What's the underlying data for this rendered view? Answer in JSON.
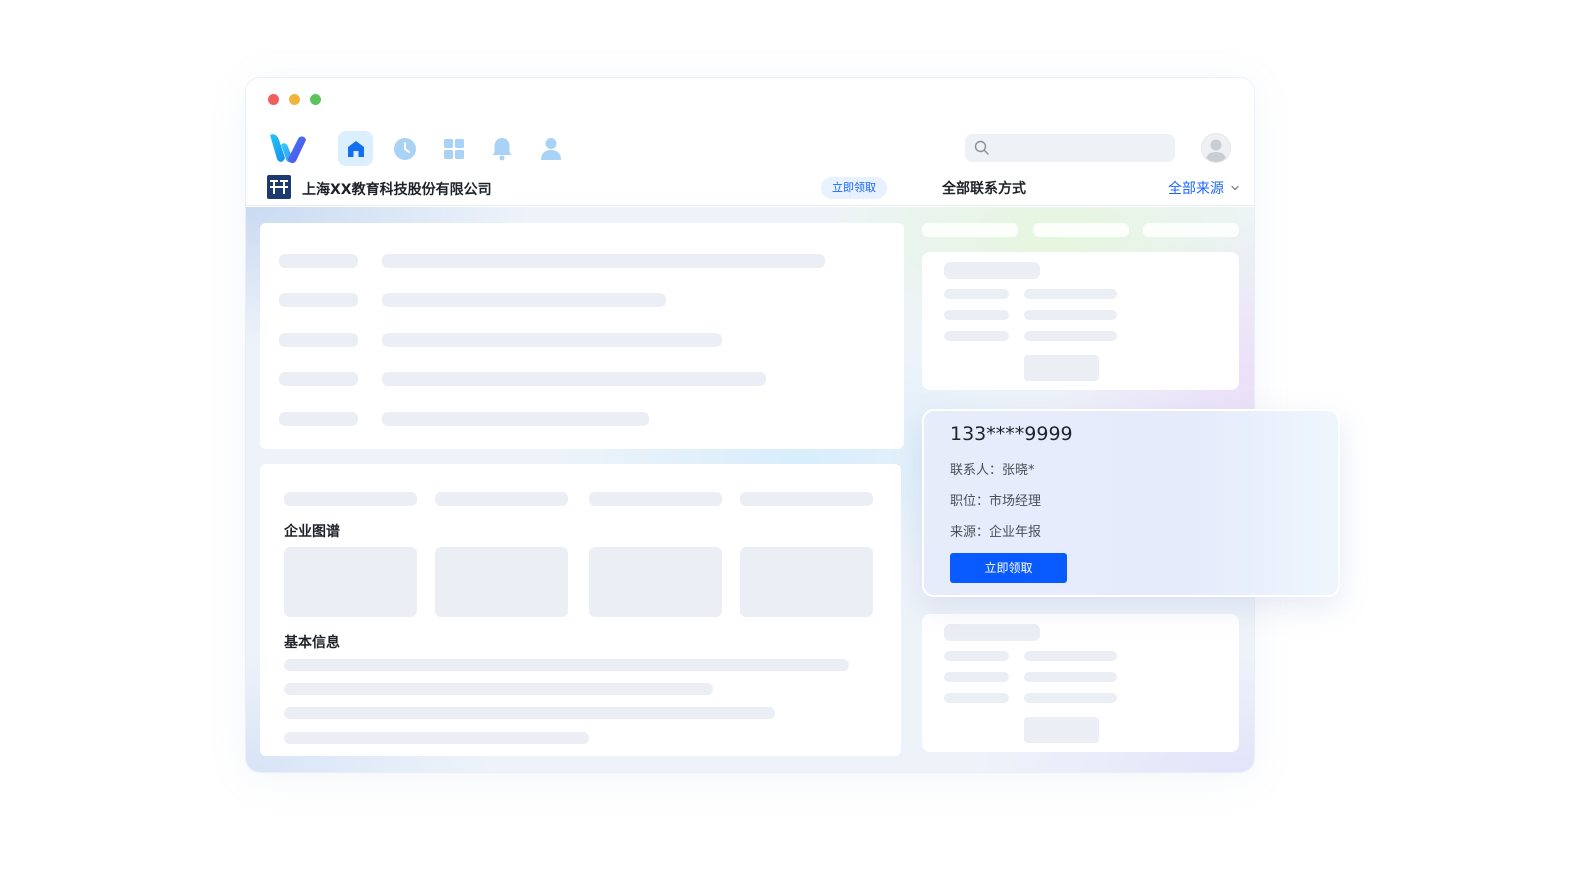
{
  "colors": {
    "traffic_red": "#ef5f5c",
    "traffic_yellow": "#f0b43b",
    "traffic_green": "#5cc45e",
    "accent_blue": "#1a66ff",
    "button_blue": "#0a5bff",
    "skeleton": "#eceef5"
  },
  "navbar": {
    "icons": [
      "home-icon",
      "history-icon",
      "apps-grid-icon",
      "bell-icon",
      "user-icon"
    ],
    "active_icon": "home-icon"
  },
  "company_bar": {
    "company_name": "上海XX教育科技股份有限公司",
    "claim_label": "立即领取",
    "contact_title": "全部联系方式",
    "source_filter": "全部来源"
  },
  "main": {
    "graph_title": "企业图谱",
    "basic_info_title": "基本信息"
  },
  "popup": {
    "phone": "133****9999",
    "contact": "联系人：张晓*",
    "position": "职位：市场经理",
    "source": "来源：企业年报",
    "button_label": "立即领取"
  }
}
